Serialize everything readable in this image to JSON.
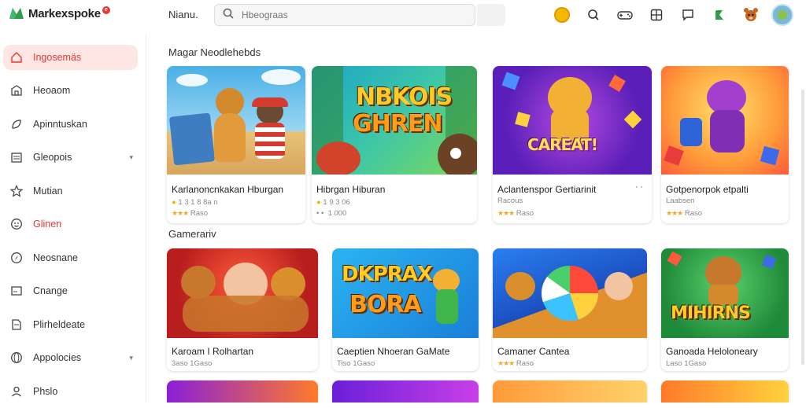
{
  "app": {
    "logo_text": "Markexspoke",
    "logo_badge": "e",
    "nav_label": "Nianu."
  },
  "search": {
    "placeholder": "Hbeograas"
  },
  "top_icons": [
    "coin-icon",
    "search-icon",
    "controller-icon",
    "grid-icon",
    "chat-icon",
    "app-icon",
    "mascot-icon",
    "avatar"
  ],
  "sidebar": {
    "items": [
      {
        "label": "Ingosemäs",
        "icon": "home-icon",
        "active": true
      },
      {
        "label": "Heoaom",
        "icon": "building-icon"
      },
      {
        "label": "Apinntuskan",
        "icon": "leaf-icon"
      },
      {
        "label": "Gleopois",
        "icon": "calendar-icon",
        "chevron": true
      },
      {
        "label": "Mutian",
        "icon": "star-icon"
      },
      {
        "label": "Glinen",
        "icon": "smile-icon",
        "red": true
      },
      {
        "label": "Neosnane",
        "icon": "compass-icon"
      },
      {
        "label": "Cnange",
        "icon": "image-icon"
      },
      {
        "label": "Plirheldeate",
        "icon": "document-icon"
      },
      {
        "label": "Appolocies",
        "icon": "globe-icon",
        "chevron": true
      },
      {
        "label": "Phslo",
        "icon": "user-icon"
      }
    ]
  },
  "sections": [
    {
      "title": "Magar Neodlehebds",
      "cards": [
        {
          "title": "Karlanoncnkakan Hburgan",
          "meta": "1 3 1 8 8a n",
          "rating": "Raso",
          "stars": "★★★",
          "thumb_text": ""
        },
        {
          "title": "Hibrgan Hiburan",
          "meta": "1 9 3 06",
          "rating": "",
          "stars": "",
          "thumb_text": "NBKOIS GHREN"
        },
        {
          "title": "Aclantenspor Gertiarinit",
          "meta": "Racous",
          "rating": "Raso",
          "stars": "★★★",
          "thumb_text": "CAREAT!",
          "more": "⠁⠁"
        },
        {
          "title": "Gotpenorpok etpalti",
          "meta": "Laabsen",
          "rating": "Raso",
          "stars": "★★★",
          "thumb_text": ""
        }
      ]
    },
    {
      "title": "Gamerariv",
      "cards": [
        {
          "title": "Karoam I Rolhartan",
          "meta": "3aso 1Gaso",
          "rating": "",
          "stars": "",
          "thumb_text": ""
        },
        {
          "title": "Caeptien Nhoeran GaMate",
          "meta": "Tiso 1Gaso",
          "rating": "",
          "stars": "",
          "thumb_text": "DKPRAX BORA"
        },
        {
          "title": "Camaner Cantea",
          "meta": "",
          "rating": "Raso",
          "stars": "★★★",
          "thumb_text": ""
        },
        {
          "title": "Ganoada Heloloneary",
          "meta": "Laso 1Gaso",
          "rating": "",
          "stars": "",
          "thumb_text": "MIHIRNS"
        }
      ]
    }
  ],
  "colors": {
    "accent": "#e53935",
    "active_bg": "#fde6e4",
    "star": "#f5a623"
  }
}
